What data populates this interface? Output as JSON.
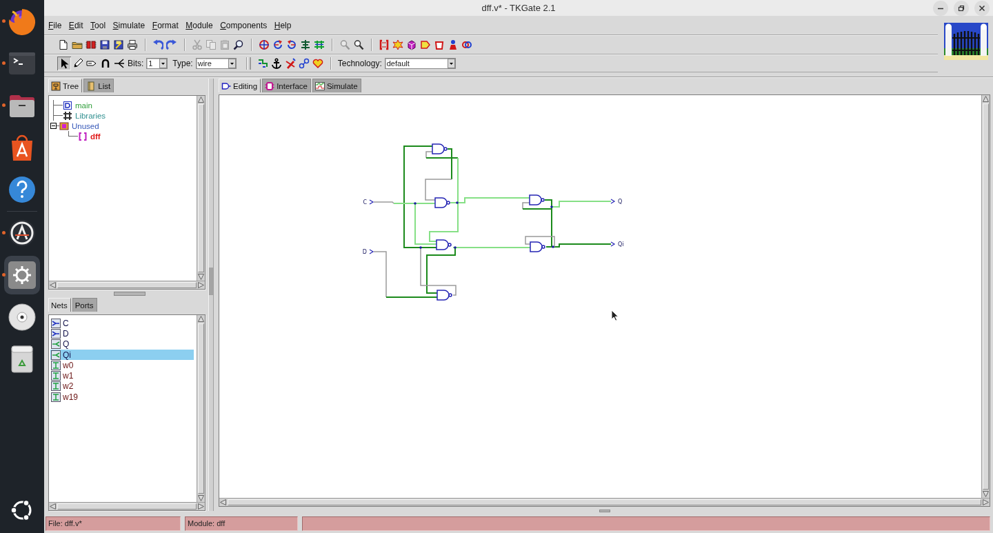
{
  "dock": {
    "groups": [
      {
        "items": [
          {
            "kind": "browser",
            "running": true,
            "selected": false
          },
          {
            "kind": "terminal",
            "running": true,
            "selected": false
          },
          {
            "kind": "files",
            "running": true,
            "selected": false
          },
          {
            "kind": "store",
            "running": false,
            "selected": false
          },
          {
            "kind": "help",
            "running": false,
            "selected": false
          }
        ]
      },
      {
        "items": [
          {
            "kind": "updater",
            "running": true,
            "selected": false
          },
          {
            "kind": "settings",
            "running": true,
            "selected": true
          },
          {
            "kind": "disc",
            "running": false,
            "selected": false
          },
          {
            "kind": "trash",
            "running": false,
            "selected": false
          }
        ]
      }
    ]
  },
  "window": {
    "title": "dff.v* - TKGate 2.1"
  },
  "menu": [
    "File",
    "Edit",
    "Tool",
    "Simulate",
    "Format",
    "Module",
    "Components",
    "Help"
  ],
  "toolbar_1": {
    "groups": [
      {
        "buttons": [
          {
            "kind": "page",
            "disabled": false
          },
          {
            "kind": "folder",
            "disabled": false
          },
          {
            "kind": "chips",
            "disabled": false
          },
          {
            "kind": "floppy",
            "disabled": false
          },
          {
            "kind": "saveas",
            "disabled": false
          },
          {
            "kind": "printer",
            "disabled": false
          }
        ]
      },
      {
        "buttons": [
          {
            "kind": "undo",
            "disabled": false
          },
          {
            "kind": "redo",
            "disabled": false
          }
        ]
      },
      {
        "buttons": [
          {
            "kind": "cut",
            "disabled": true
          },
          {
            "kind": "copy",
            "disabled": true
          },
          {
            "kind": "paste",
            "disabled": true
          },
          {
            "kind": "find",
            "disabled": false
          }
        ]
      },
      {
        "buttons": [
          {
            "kind": "target",
            "disabled": false
          },
          {
            "kind": "rotl",
            "disabled": false
          },
          {
            "kind": "rotr",
            "disabled": false
          },
          {
            "kind": "align",
            "disabled": false
          },
          {
            "kind": "grid",
            "disabled": false
          }
        ]
      },
      {
        "buttons": [
          {
            "kind": "zoom",
            "disabled": true
          },
          {
            "kind": "zoom",
            "disabled": false
          }
        ]
      },
      {
        "buttons": [
          {
            "kind": "bracket",
            "disabled": false
          },
          {
            "kind": "burst",
            "disabled": false
          },
          {
            "kind": "cube",
            "disabled": false
          },
          {
            "kind": "tag",
            "disabled": false
          },
          {
            "kind": "cup",
            "disabled": false
          },
          {
            "kind": "figure",
            "disabled": false
          },
          {
            "kind": "rings",
            "disabled": false
          }
        ]
      }
    ]
  },
  "toolbar_2": {
    "tools": [
      {
        "kind": "pointer",
        "selected": true
      },
      {
        "kind": "pencil",
        "selected": false
      },
      {
        "kind": "label",
        "selected": false
      },
      {
        "kind": "horseshoe",
        "selected": false
      },
      {
        "kind": "fan",
        "selected": false
      }
    ],
    "bits": {
      "label": "Bits:",
      "value": "1"
    },
    "type": {
      "label": "Type:",
      "value": "wire"
    },
    "actions": [
      {
        "kind": "stairs"
      },
      {
        "kind": "anchor"
      },
      {
        "kind": "crosspen"
      },
      {
        "kind": "chain"
      },
      {
        "kind": "heart"
      }
    ],
    "technology": {
      "label": "Technology:",
      "value": "default"
    }
  },
  "module_panel": {
    "tabs": [
      {
        "label": "Tree",
        "kind": "tree",
        "selected": true
      },
      {
        "label": "List",
        "kind": "list",
        "selected": false
      }
    ],
    "tree": [
      {
        "label": "main",
        "kind": "module",
        "color": "#2f9e3a"
      },
      {
        "label": "Libraries",
        "kind": "library",
        "color": "#2f8f8f"
      },
      {
        "label": "Unused",
        "kind": "box",
        "color": "#3658b8",
        "expanded": true,
        "children": [
          {
            "label": "dff",
            "kind": "bracket",
            "color": "#e01818"
          }
        ]
      }
    ]
  },
  "nets_panel": {
    "tabs": [
      {
        "label": "Nets",
        "selected": true
      },
      {
        "label": "Ports",
        "selected": false
      }
    ],
    "nets": [
      {
        "name": "C",
        "kind": "input",
        "selected": false
      },
      {
        "name": "D",
        "kind": "input",
        "selected": false
      },
      {
        "name": "Q",
        "kind": "output",
        "selected": false
      },
      {
        "name": "Qi",
        "kind": "output",
        "selected": true
      },
      {
        "name": "w0",
        "kind": "wire",
        "selected": false
      },
      {
        "name": "w1",
        "kind": "wire",
        "selected": false
      },
      {
        "name": "w2",
        "kind": "wire",
        "selected": false
      },
      {
        "name": "w19",
        "kind": "wire",
        "selected": false
      }
    ]
  },
  "editor": {
    "tabs": [
      {
        "label": "Editing",
        "kind": "editing",
        "selected": true
      },
      {
        "label": "Interface",
        "kind": "interface",
        "selected": false
      },
      {
        "label": "Simulate",
        "kind": "simulate",
        "selected": false
      }
    ],
    "ports": [
      {
        "name": "C",
        "kind": "input"
      },
      {
        "name": "D",
        "kind": "input"
      },
      {
        "name": "Q",
        "kind": "output"
      },
      {
        "name": "Qi",
        "kind": "output"
      }
    ]
  },
  "status_bar": {
    "fields": [
      "File: dff.v*",
      "Module: dff"
    ]
  }
}
